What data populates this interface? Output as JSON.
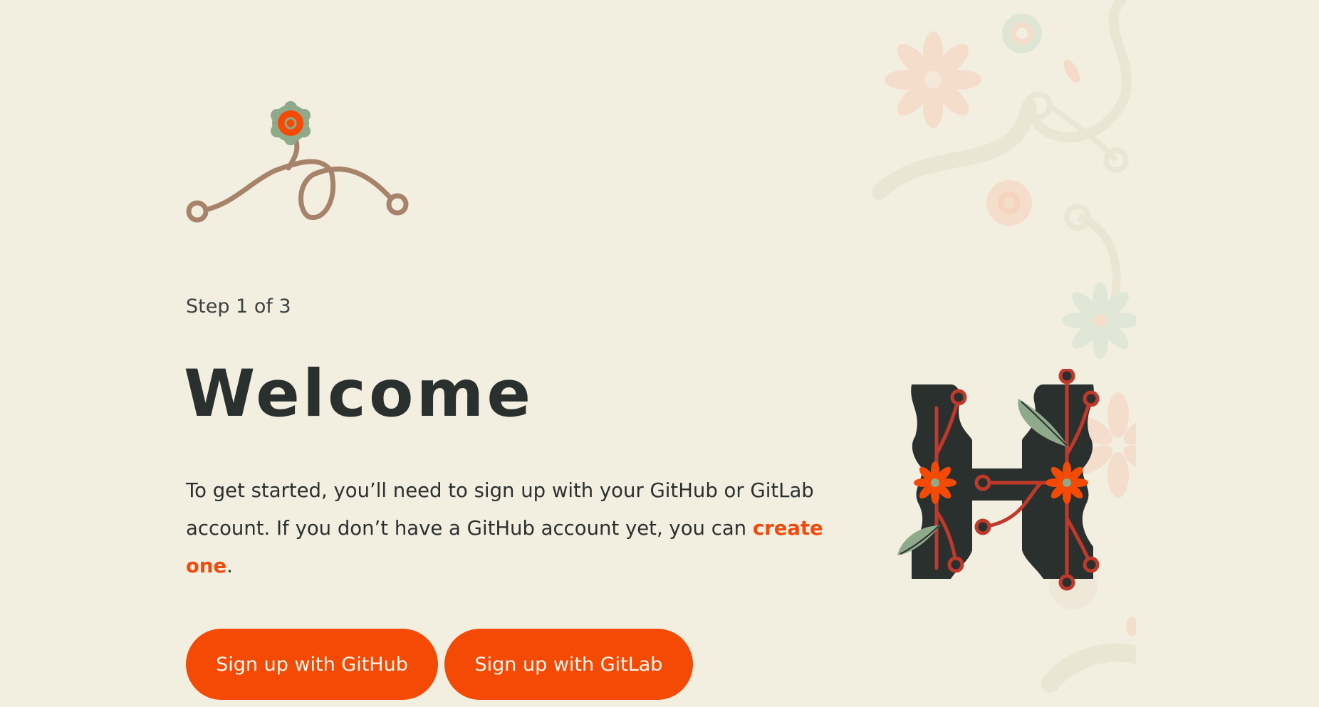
{
  "page": {
    "step_label": "Step 1 of 3",
    "title": "Welcome",
    "description_before_link": "To get started, you’ll need to sign up with your GitHub or GitLab account. If you don’t have a GitHub account yet, you can ",
    "description_link": "create one",
    "description_after_link": "."
  },
  "buttons": {
    "github_label": "Sign up with GitHub",
    "gitlab_label": "Sign up with GitLab"
  },
  "icons": {
    "logo": "flower-vine-logo-icon",
    "emblem": "floral-h-monogram-icon",
    "background": "floral-background-decoration"
  },
  "colors": {
    "background": "#F2EFE1",
    "accent": "#F54A06",
    "link": "#F04A0C",
    "text": "#2A302E",
    "vine": "#A8836B",
    "leaf": "#8FAA8B",
    "emblem_dark": "#2A302E",
    "emblem_red": "#C0392B"
  }
}
